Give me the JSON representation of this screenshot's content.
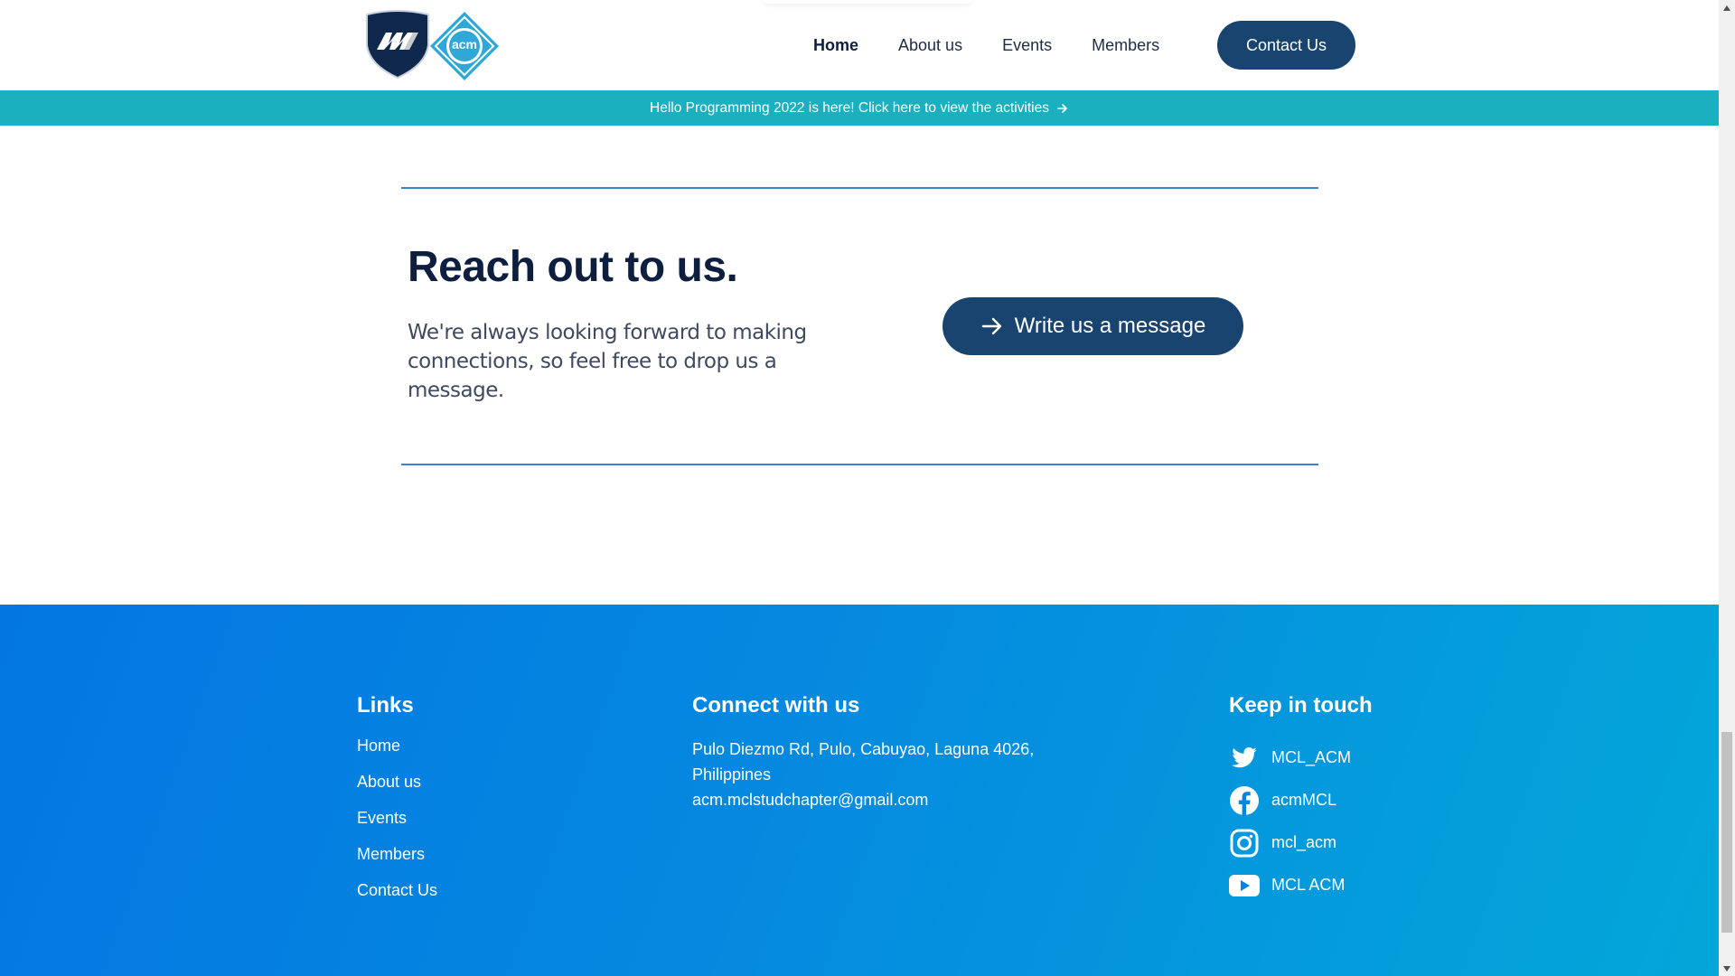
{
  "navbar": {
    "nav_links": [
      "Home",
      "About us",
      "Events",
      "Members"
    ],
    "active_link": "Home",
    "contact_button": "Contact Us",
    "logo_text": "acm"
  },
  "announcement": {
    "text": "Hello Programming 2022 is here! Click here to view the activities"
  },
  "reach_out": {
    "title": "Reach out to us.",
    "text": "We're always looking forward to making connections, so feel free to drop us a message.",
    "button_label": "Write us a message"
  },
  "footer": {
    "links_heading": "Links",
    "links": [
      "Home",
      "About us",
      "Events",
      "Members",
      "Contact Us"
    ],
    "connect_heading": "Connect with us",
    "address": "Pulo Diezmo Rd, Pulo, Cabuyao, Laguna 4026, Philippines",
    "email": "acm.mclstudchapter@gmail.com",
    "keep_heading": "Keep in touch",
    "socials": [
      {
        "icon": "twitter-icon",
        "label": "MCL_ACM"
      },
      {
        "icon": "facebook-icon",
        "label": "acmMCL"
      },
      {
        "icon": "instagram-icon",
        "label": "mcl_acm"
      },
      {
        "icon": "youtube-icon",
        "label": "MCL ACM"
      }
    ]
  },
  "colors": {
    "primary_dark": "#1a4470",
    "announcement_bg": "#1bb0bf",
    "footer_gradient_start": "#0376e2",
    "footer_gradient_end": "#03a7d9",
    "heading": "#0d1e3f"
  }
}
